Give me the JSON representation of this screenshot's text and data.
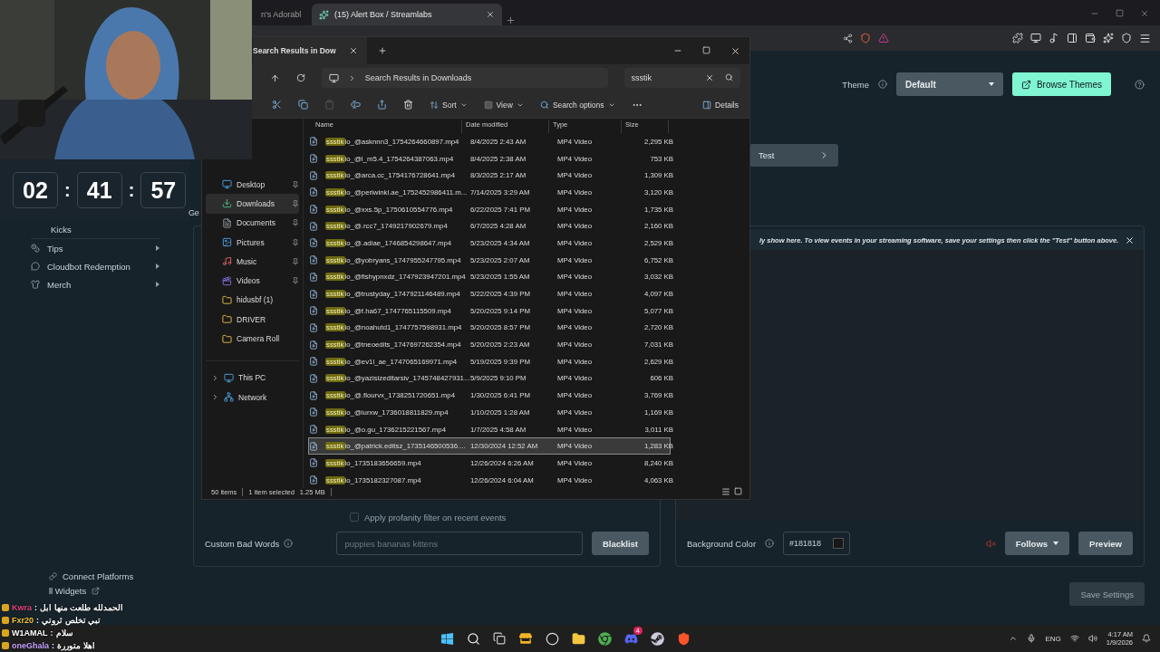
{
  "browser": {
    "tabs": [
      {
        "title": "n's Adorabl",
        "selected": false
      },
      {
        "title": "(15) Alert Box / Streamlabs",
        "selected": true
      }
    ]
  },
  "streamlabs": {
    "sidebar": [
      {
        "label": "Kicks",
        "kind": "child"
      },
      {
        "label": "Tips",
        "kind": "menu"
      },
      {
        "label": "Cloudbot Redemption",
        "kind": "menu"
      },
      {
        "label": "Merch",
        "kind": "menu"
      }
    ],
    "footer_links": [
      "Connect Platforms",
      "ll Widgets"
    ],
    "theme": {
      "label": "Theme",
      "value": "Default"
    },
    "browse_button": "Browse Themes",
    "test_button": "Test",
    "left_panel": {
      "fragment": "Ge",
      "profanity": {
        "label": "Apply profanity filter on recent events",
        "checked": false
      },
      "bad_words": {
        "label": "Custom Bad Words",
        "placeholder": "puppies bananas kittens",
        "button": "Blacklist"
      }
    },
    "right_panel": {
      "notice": "ly show here. To view events in your streaming software, save your settings then click the \"Test\" button above.",
      "background_color": {
        "label": "Background Color",
        "value": "#181818"
      },
      "event_select": "Follows",
      "preview_button": "Preview"
    },
    "save_button": "Save Settings"
  },
  "explorer": {
    "tab_title": "Search Results in Dow",
    "breadcrumb": "Search Results in Downloads",
    "search_value": "ssstik",
    "toolbar": {
      "sort": "Sort",
      "view": "View",
      "search_options": "Search options",
      "details": "Details"
    },
    "nav": [
      {
        "label": "Desktop",
        "selected": false,
        "pinned": true
      },
      {
        "label": "Downloads",
        "selected": true,
        "pinned": true
      },
      {
        "label": "Documents",
        "selected": false,
        "pinned": true
      },
      {
        "label": "Pictures",
        "selected": false,
        "pinned": true
      },
      {
        "label": "Music",
        "selected": false,
        "pinned": true
      },
      {
        "label": "Videos",
        "selected": false,
        "pinned": true
      },
      {
        "label": "hidusbf (1)",
        "selected": false,
        "pinned": false
      },
      {
        "label": "DRIVER",
        "selected": false,
        "pinned": false
      },
      {
        "label": "Camera Roll",
        "selected": false,
        "pinned": false
      }
    ],
    "tree": [
      {
        "label": "This PC",
        "expanded": false
      },
      {
        "label": "Network",
        "expanded": false
      }
    ],
    "columns": [
      "Name",
      "Date modified",
      "Type",
      "Size"
    ],
    "files": [
      {
        "match": "ssstik",
        "name": "io_@asknnn3_1754264660897.mp4",
        "date": "8/4/2025 2:43 AM",
        "type": "MP4 Video",
        "size": "2,295 KB",
        "selected": false
      },
      {
        "match": "ssstik",
        "name": "io_@l_m5.4_1754264387063.mp4",
        "date": "8/4/2025 2:38 AM",
        "type": "MP4 Video",
        "size": "753 KB",
        "selected": false
      },
      {
        "match": "ssstik",
        "name": "io_@arca.cc_1754176728641.mp4",
        "date": "8/3/2025 2:17 AM",
        "type": "MP4 Video",
        "size": "1,309 KB",
        "selected": false
      },
      {
        "match": "ssstik",
        "name": "io_@periwinkl.ae_1752452986411.m...",
        "date": "7/14/2025 3:29 AM",
        "type": "MP4 Video",
        "size": "3,120 KB",
        "selected": false
      },
      {
        "match": "ssstik",
        "name": "io_@xxs.5p_1750610554776.mp4",
        "date": "6/22/2025 7:41 PM",
        "type": "MP4 Video",
        "size": "1,735 KB",
        "selected": false
      },
      {
        "match": "ssstik",
        "name": "io_@.rcc7_1749217902679.mp4",
        "date": "6/7/2025 4:28 AM",
        "type": "MP4 Video",
        "size": "2,160 KB",
        "selected": false
      },
      {
        "match": "ssstik",
        "name": "io_@.adiae_1746854298647.mp4",
        "date": "5/23/2025 4:34 AM",
        "type": "MP4 Video",
        "size": "2,529 KB",
        "selected": false
      },
      {
        "match": "ssstik",
        "name": "io_@yobryans_1747955247795.mp4",
        "date": "5/23/2025 2:07 AM",
        "type": "MP4 Video",
        "size": "6,752 KB",
        "selected": false
      },
      {
        "match": "ssstik",
        "name": "io_@fishypnxdz_1747923947201.mp4",
        "date": "5/23/2025 1:55 AM",
        "type": "MP4 Video",
        "size": "3,032 KB",
        "selected": false
      },
      {
        "match": "ssstik",
        "name": "io_@trustyday_1747921146489.mp4",
        "date": "5/22/2025 4:39 PM",
        "type": "MP4 Video",
        "size": "4,097 KB",
        "selected": false
      },
      {
        "match": "ssstik",
        "name": "io_@f.ha67_1747765115509.mp4",
        "date": "5/20/2025 9:14 PM",
        "type": "MP4 Video",
        "size": "5,077 KB",
        "selected": false
      },
      {
        "match": "ssstik",
        "name": "io_@noahutd1_1747757598931.mp4",
        "date": "5/20/2025 8:57 PM",
        "type": "MP4 Video",
        "size": "2,720 KB",
        "selected": false
      },
      {
        "match": "ssstik",
        "name": "io_@tneoedits_1747697262354.mp4",
        "date": "5/20/2025 2:23 AM",
        "type": "MP4 Video",
        "size": "7,031 KB",
        "selected": false
      },
      {
        "match": "ssstik",
        "name": "io_@ev1l_ae_1747065169971.mp4",
        "date": "5/19/2025 9:39 PM",
        "type": "MP4 Video",
        "size": "2,629 KB",
        "selected": false
      },
      {
        "match": "ssstik",
        "name": "io_@yazisizeditarsiv_1745748427931...",
        "date": "5/9/2025 9:10 PM",
        "type": "MP4 Video",
        "size": "606 KB",
        "selected": false
      },
      {
        "match": "ssstik",
        "name": "io_@.flourvx_1738251720651.mp4",
        "date": "1/30/2025 6:41 PM",
        "type": "MP4 Video",
        "size": "3,769 KB",
        "selected": false
      },
      {
        "match": "ssstik",
        "name": "io_@iurxw_1736018811829.mp4",
        "date": "1/10/2025 1:28 AM",
        "type": "MP4 Video",
        "size": "1,169 KB",
        "selected": false
      },
      {
        "match": "ssstik",
        "name": "io_@o.gu_1736215221567.mp4",
        "date": "1/7/2025 4:58 AM",
        "type": "MP4 Video",
        "size": "3,011 KB",
        "selected": false
      },
      {
        "match": "ssstik",
        "name": "io_@patrick.editsz_1735146500536....",
        "date": "12/30/2024 12:52 AM",
        "type": "MP4 Video",
        "size": "1,283 KB",
        "selected": true
      },
      {
        "match": "ssstik",
        "name": "io_1735183656659.mp4",
        "date": "12/26/2024 6:26 AM",
        "type": "MP4 Video",
        "size": "8,240 KB",
        "selected": false
      },
      {
        "match": "ssstik",
        "name": "io_1735182327087.mp4",
        "date": "12/26/2024 6:04 AM",
        "type": "MP4 Video",
        "size": "4,063 KB",
        "selected": false
      }
    ],
    "status": {
      "count": "50 items",
      "selection": "1 item selected",
      "size": "1.25 MB"
    }
  },
  "timer": [
    {
      "kind": "digits",
      "text": "02"
    },
    {
      "kind": "colon",
      "text": ":"
    },
    {
      "kind": "digits",
      "text": "41"
    },
    {
      "kind": "colon",
      "text": ":"
    },
    {
      "kind": "digits",
      "text": "57"
    }
  ],
  "chat": [
    {
      "user": "Kwra",
      "separator": ":",
      "message": "الحمدلله طلعت منها ابل",
      "color": "#e0457b"
    },
    {
      "user": "Fxr20",
      "separator": ":",
      "message": "تبي تخلص ثروتي",
      "color": "#f2c230"
    },
    {
      "user": "W1AMAL",
      "separator": ":",
      "message": "سلام",
      "color": "#ffffff"
    },
    {
      "user": "oneGhala",
      "separator": ":",
      "message": "اهلا متوررة",
      "color": "#c9a2ff"
    }
  ],
  "taskbar": {
    "badge": "4",
    "language": "ENG",
    "time": "4:17 AM",
    "date": "1/9/2026"
  }
}
